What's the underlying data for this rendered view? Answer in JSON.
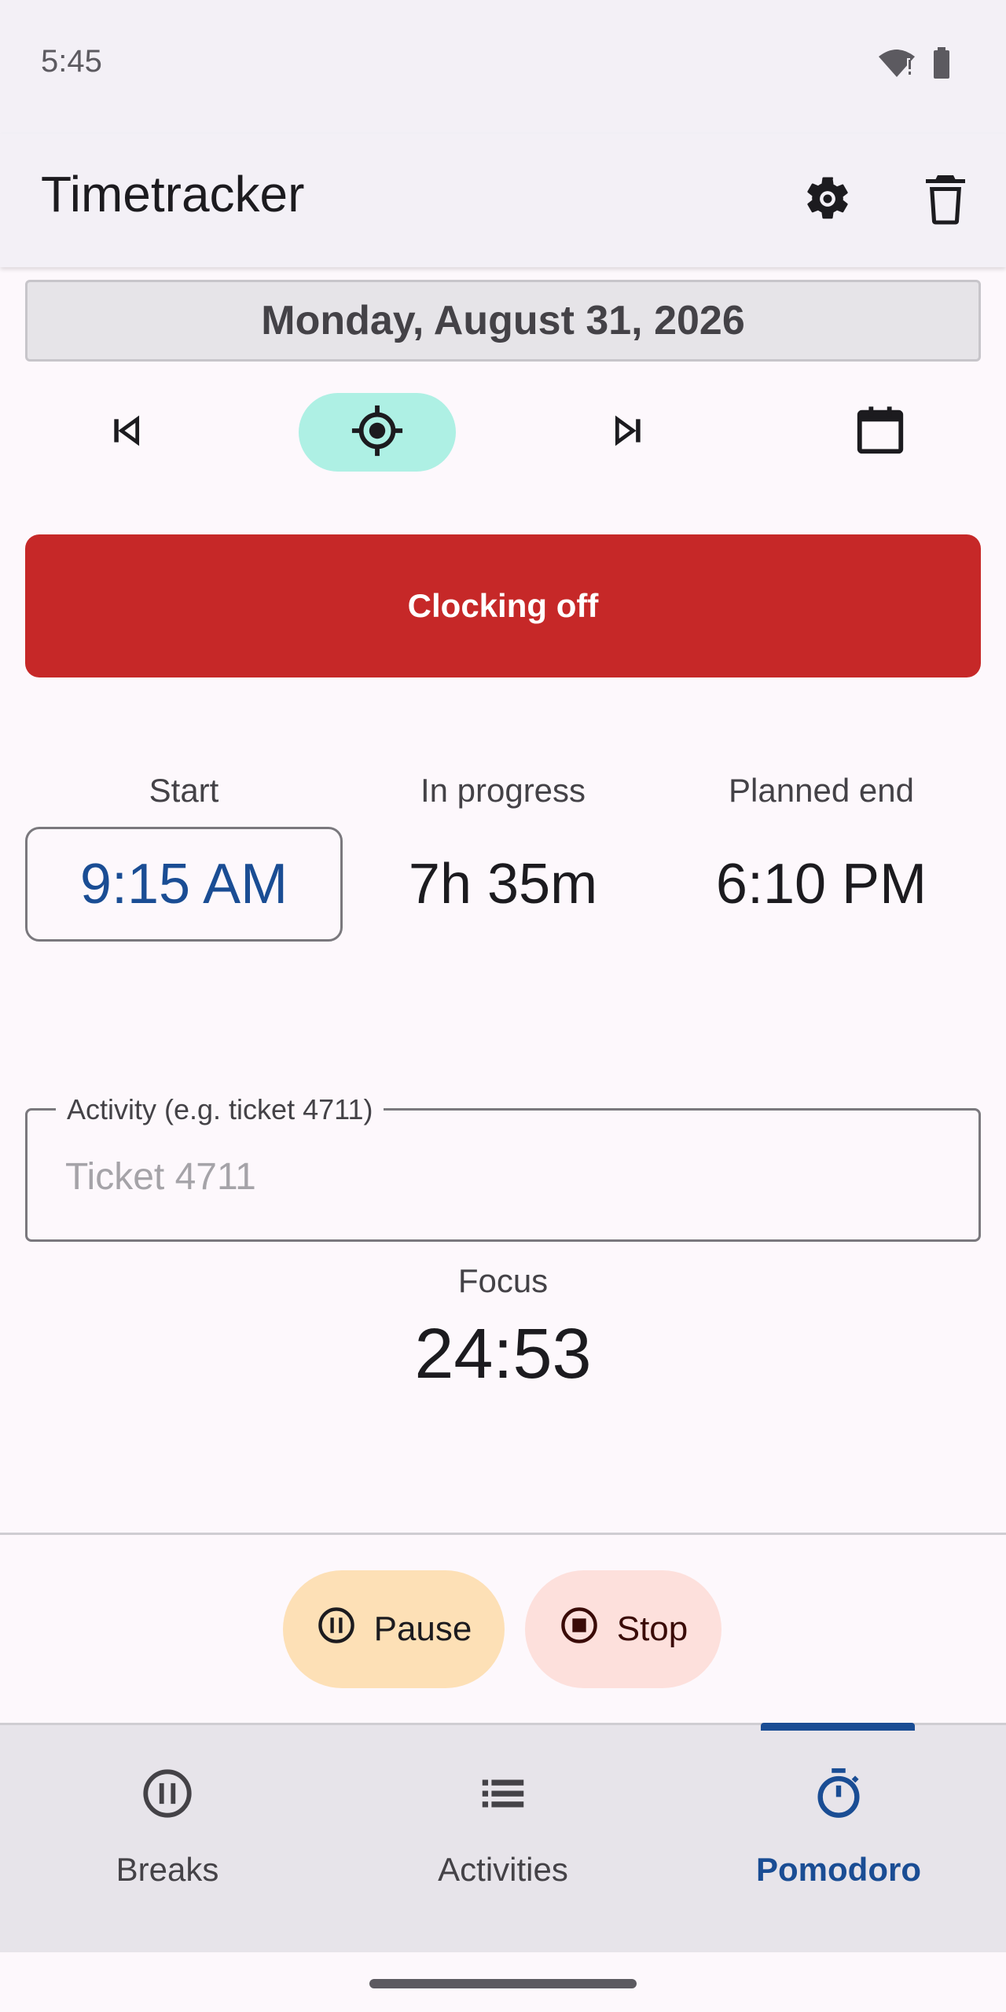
{
  "status": {
    "time": "5:45"
  },
  "app_bar": {
    "title": "Timetracker",
    "settings_icon": "gear-icon",
    "delete_icon": "trash-icon"
  },
  "date": {
    "label": "Monday, August 31, 2026"
  },
  "nav": {
    "prev_icon": "skip-previous-icon",
    "today_icon": "target-icon",
    "next_icon": "skip-next-icon",
    "calendar_icon": "calendar-icon",
    "active_color": "#aef0e4"
  },
  "clock": {
    "label": "Clocking off",
    "color": "#c62828"
  },
  "times": {
    "start_label": "Start",
    "start_value": "9:15 AM",
    "progress_label": "In progress",
    "progress_value": "7h 35m",
    "end_label": "Planned end",
    "end_value": "6:10 PM"
  },
  "activity": {
    "label": "Activity (e.g. ticket 4711)",
    "placeholder": "Ticket 4711",
    "value": ""
  },
  "focus": {
    "label": "Focus",
    "time": "24:53"
  },
  "controls": {
    "pause_label": "Pause",
    "stop_label": "Stop"
  },
  "bottom_nav": {
    "items": [
      {
        "label": "Breaks",
        "icon": "pause-circle-icon"
      },
      {
        "label": "Activities",
        "icon": "list-icon"
      },
      {
        "label": "Pomodoro",
        "icon": "stopwatch-icon",
        "active": true
      }
    ],
    "accent": "#1a4d94"
  }
}
